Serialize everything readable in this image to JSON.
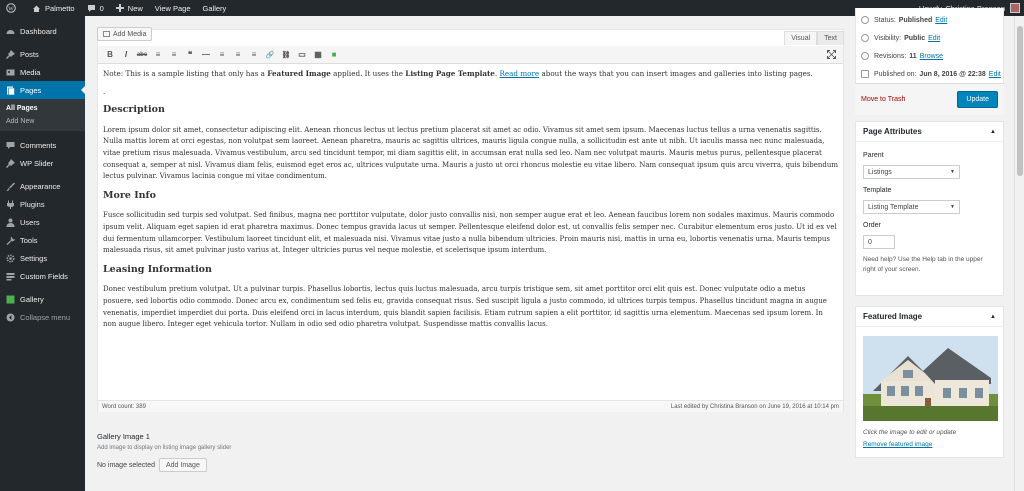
{
  "admin_bar": {
    "site_name": "Palmetto",
    "comments_count": "0",
    "new_label": "New",
    "view_page": "View Page",
    "gallery": "Gallery",
    "howdy": "Howdy, Christina Branson"
  },
  "sidebar": {
    "items": [
      {
        "label": "Dashboard",
        "icon": "dashboard-icon"
      },
      {
        "label": "Posts",
        "icon": "pin-icon"
      },
      {
        "label": "Media",
        "icon": "media-icon"
      },
      {
        "label": "Pages",
        "icon": "pages-icon"
      }
    ],
    "pages_sub": [
      "All Pages",
      "Add New"
    ],
    "items2": [
      {
        "label": "Comments",
        "icon": "comment-icon"
      },
      {
        "label": "WP Slider",
        "icon": "slider-icon"
      }
    ],
    "items3": [
      {
        "label": "Appearance",
        "icon": "brush-icon"
      },
      {
        "label": "Plugins",
        "icon": "plugin-icon"
      },
      {
        "label": "Users",
        "icon": "users-icon"
      },
      {
        "label": "Tools",
        "icon": "tools-icon"
      },
      {
        "label": "Settings",
        "icon": "settings-icon"
      },
      {
        "label": "Custom Fields",
        "icon": "fields-icon"
      }
    ],
    "gallery": "Gallery",
    "collapse": "Collapse menu"
  },
  "editor": {
    "add_media": "Add Media",
    "tab_visual": "Visual",
    "tab_text": "Text",
    "toolbar": [
      "B",
      "I",
      "abc",
      "≡",
      "≡",
      "❝",
      "—",
      "≡",
      "≡",
      "≡",
      "🔗",
      "⛓",
      "▭",
      "▦",
      "■"
    ],
    "note_pre": "Note: This is a sample listing that only has a ",
    "note_b1": "Featured Image",
    "note_mid": " applied. It uses the ",
    "note_b2": "Listing Page Template",
    "note_dot": ".",
    "note_link": "Read more",
    "note_post": " about the ways that you can insert images and galleries into listing pages.",
    "dot": ".",
    "h_description": "Description",
    "p_description": "Lorem ipsum dolor sit amet, consectetur adipiscing elit. Aenean rhoncus lectus ut lectus pretium placerat sit amet ac odio. Vivamus sit amet sem ipsum. Maecenas luctus tellus a urna venenatis sagittis. Nulla mattis lorem at orci egestas, non volutpat sem laoreet. Aenean pharetra, mauris ac sagittis ultrices, mauris ligula congue nulla, a sollicitudin est ante ut nibh. Ut iaculis massa nec nunc malesuada, vitae pretium risus malesuada. Vivamus vestibulum, arcu sed tincidunt tempor, mi diam sagittis elit, in accumsan erat nulla sed leo. Nam nec volutpat mauris. Mauris metus purus, pellentesque placerat consequat a, semper at nisl. Vivamus diam felis, euismod eget eros ac, ultrices vulputate urna. Mauris a justo ut orci rhoncus molestie eu vitae libero. Nam consequat ipsum quis arcu viverra, quis bibendum lectus pulvinar. Vivamus lacinia congue mi vitae condimentum.",
    "h_more": "More Info",
    "p_more": "Fusce sollicitudin sed turpis sed volutpat. Sed finibus, magna nec porttitor vulputate, dolor justo convallis nisi, non semper augue erat et leo. Aenean faucibus lorem non sodales maximus. Mauris commodo ipsum velit. Aliquam eget sapien id erat pharetra maximus. Donec tempus gravida lacus ut semper. Pellentesque eleifend dolor est, ut convallis felis semper nec. Curabitur elementum eros justo. Ut id ex vel dui fermentum ullamcorper. Vestibulum laoreet tincidunt elit, et malesuada nisi. Vivamus vitae justo a nulla bibendum ultricies. Proin mauris nisi, mattis in urna eu, lobortis venenatis urna. Mauris tempus malesuada risus, sit amet pulvinar justo varius at. Integer ultricies purus vel neque molestie, et scelerisque ipsum interdum.",
    "h_leasing": "Leasing Information",
    "p_leasing": "Donec vestibulum pretium volutpat. Ut a pulvinar turpis. Phasellus lobortis, lectus quis luctus malesuada, arcu turpis tristique sem, sit amet porttitor orci elit quis est. Donec vulputate odio a metus posuere, sed lobortis odio commodo. Donec arcu ex, condimentum sed felis eu, gravida consequat risus. Sed suscipit ligula a justo commodo, id ultrices turpis tempus. Phasellus tincidunt magna in augue venenatis, imperdiet imperdiet dui porta. Duis eleifend orci in lacus interdum, quis blandit sapien facilisis. Etiam rutrum sapien a elit porttitor, id sagittis urna elementum. Maecenas sed ipsum lorem. In non augue libero. Integer eget vehicula tortor. Nullam in odio sed odio pharetra volutpat. Suspendisse mattis convallis lacus.",
    "word_count": "Word count: 389",
    "last_edited": "Last edited by Christina Branson on June 19, 2016 at 10:14 pm"
  },
  "gallery_box": {
    "title": "Gallery Image 1",
    "desc": "Add image to display on listing image gallery slider",
    "no_image": "No image selected",
    "add_image": "Add Image"
  },
  "publish": {
    "status_label": "Status:",
    "status_value": "Published",
    "visibility_label": "Visibility:",
    "visibility_value": "Public",
    "revisions_label": "Revisions:",
    "revisions_value": "11",
    "published_label": "Published on:",
    "published_value": "Jun 8, 2016 @ 22:38",
    "edit": "Edit",
    "browse": "Browse",
    "trash": "Move to Trash",
    "update": "Update"
  },
  "page_attributes": {
    "title": "Page Attributes",
    "parent_label": "Parent",
    "parent_value": "Listings",
    "template_label": "Template",
    "template_value": "Listing Template",
    "order_label": "Order",
    "order_value": "0",
    "help": "Need help? Use the Help tab in the upper right of your screen."
  },
  "featured": {
    "title": "Featured Image",
    "caption": "Click the image to edit or update",
    "remove": "Remove featured image"
  },
  "colors": {
    "admin_bar": "#23282d",
    "accent": "#0073aa",
    "button": "#0085ba"
  }
}
